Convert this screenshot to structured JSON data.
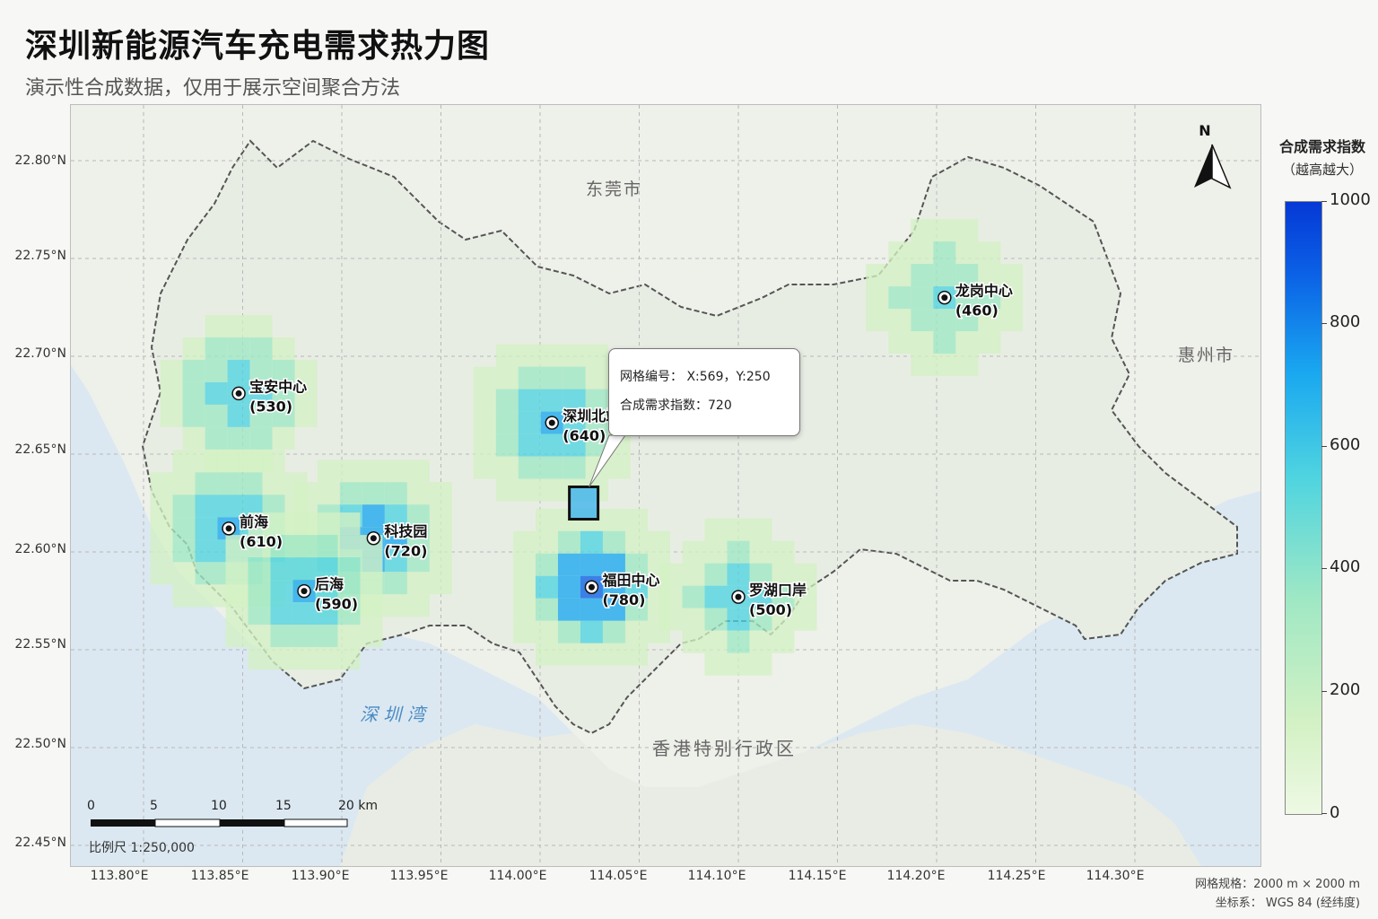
{
  "title": "深圳新能源汽车充电需求热力图",
  "subtitle": "演示性合成数据，仅用于展示空间聚合方法",
  "place_labels": {
    "dongguan": "东莞市",
    "huizhou": "惠州市",
    "shenzhen_bay": "深 圳 湾",
    "hong_kong": "香港特别行政区"
  },
  "y_axis_labels": [
    "22.80°N",
    "22.75°N",
    "22.70°N",
    "22.65°N",
    "22.60°N",
    "22.55°N",
    "22.50°N",
    "22.45°N"
  ],
  "x_axis_labels": [
    "113.80°E",
    "113.85°E",
    "113.90°E",
    "113.95°E",
    "114.00°E",
    "114.05°E",
    "114.10°E",
    "114.15°E",
    "114.20°E",
    "114.25°E",
    "114.30°E"
  ],
  "hotspots": [
    {
      "name": "宝安中心",
      "value": "(530)",
      "lon": 113.848,
      "lat": 22.681,
      "index": 530
    },
    {
      "name": "深圳北站",
      "value": "(640)",
      "lon": 114.006,
      "lat": 22.666,
      "index": 640
    },
    {
      "name": "龙岗中心",
      "value": "(460)",
      "lon": 114.204,
      "lat": 22.73,
      "index": 460
    },
    {
      "name": "前海",
      "value": "(610)",
      "lon": 113.843,
      "lat": 22.612,
      "index": 610
    },
    {
      "name": "科技园",
      "value": "(720)",
      "lon": 113.916,
      "lat": 22.607,
      "index": 720
    },
    {
      "name": "后海",
      "value": "(590)",
      "lon": 113.881,
      "lat": 22.58,
      "index": 590
    },
    {
      "name": "福田中心",
      "value": "(780)",
      "lon": 114.026,
      "lat": 22.582,
      "index": 780
    },
    {
      "name": "罗湖口岸",
      "value": "(500)",
      "lon": 114.1,
      "lat": 22.577,
      "index": 500
    }
  ],
  "selected_cell": {
    "lon": 114.022,
    "lat": 22.625
  },
  "tooltip": {
    "line1": "网格编号：  X:569，Y:250",
    "line2": "合成需求指数：720"
  },
  "north_arrow_label": "N",
  "legend": {
    "title": "合成需求指数",
    "subtitle": "（越高越大）",
    "ticks": [
      "1000",
      "800",
      "600",
      "400",
      "200",
      "0"
    ],
    "range": [
      0,
      1000
    ],
    "colors": [
      "#eef9e4",
      "#d3f1c4",
      "#9fe8c4",
      "#4fd4e0",
      "#1aa8f0",
      "#0b62e6",
      "#0538d6"
    ]
  },
  "scale_bar": {
    "ticks": [
      "0",
      "5",
      "10",
      "15",
      "20 km"
    ],
    "label": "比例尺  1:250,000"
  },
  "footer": {
    "grid": "网格规格：2000 m × 2000 m",
    "crs": "坐标系：  WGS 84 (经纬度)"
  }
}
